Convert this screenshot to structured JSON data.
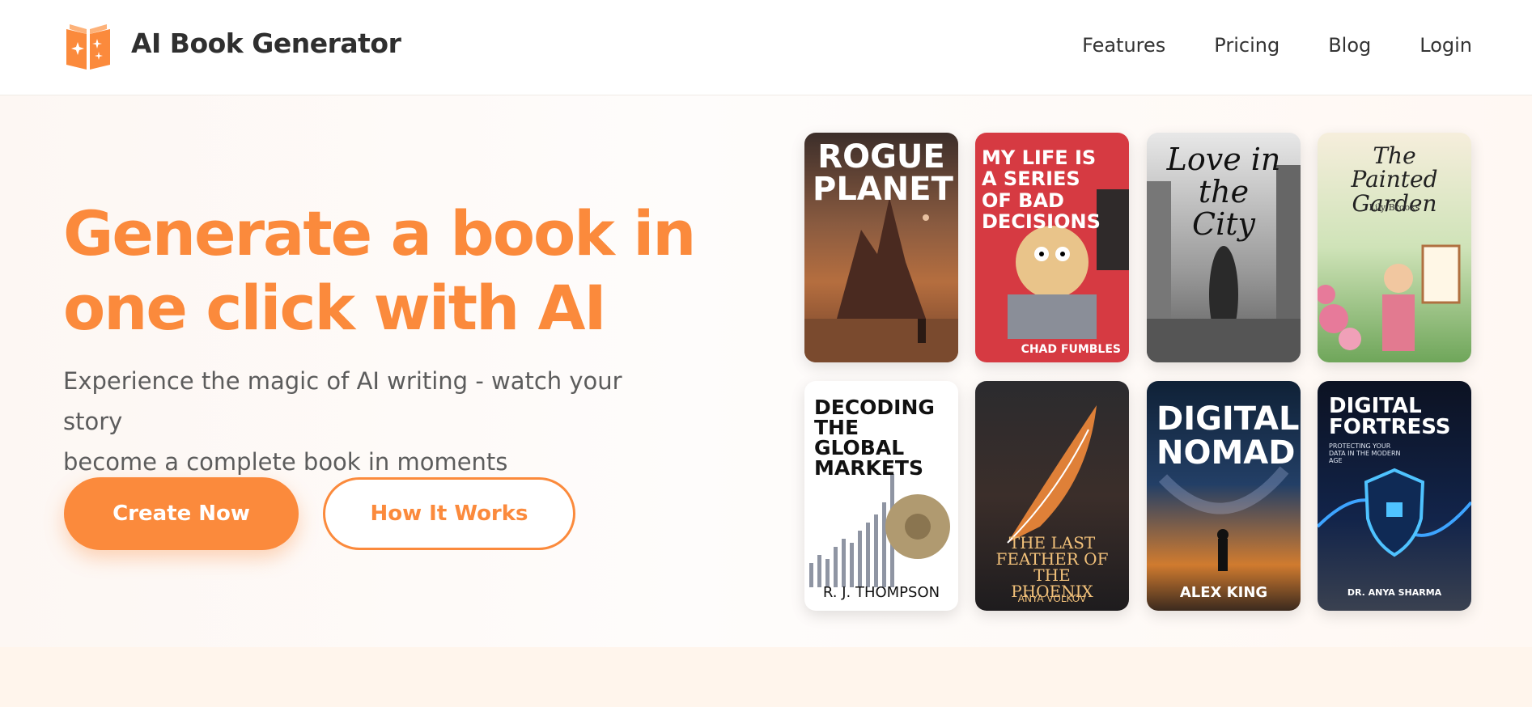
{
  "header": {
    "brand": "AI Book Generator",
    "nav": [
      "Features",
      "Pricing",
      "Blog",
      "Login"
    ]
  },
  "hero": {
    "headline_line1": "Generate a book in",
    "headline_line2": "one click with AI",
    "subtext_line1": "Experience the magic of AI writing - watch your story",
    "subtext_line2": "become a complete book in moments",
    "cta_primary": "Create Now",
    "cta_secondary": "How It Works"
  },
  "colors": {
    "accent": "#fb8a3c",
    "text_dark": "#2f2f2f",
    "text_muted": "#5c5c5c"
  },
  "books": [
    {
      "title": "ROGUE PLANET",
      "author": ""
    },
    {
      "title": "MY LIFE IS A SERIES OF BAD DECISIONS",
      "author": "CHAD FUMBLES"
    },
    {
      "title": "Love in the City",
      "author": ""
    },
    {
      "title": "The Painted Garden",
      "author": "Lily Brooks"
    },
    {
      "title": "DECODING THE GLOBAL MARKETS",
      "author": "R. J. THOMPSON"
    },
    {
      "title": "THE LAST FEATHER OF THE PHOENIX",
      "author": "ANYA VOLKOV"
    },
    {
      "title": "DIGITAL NOMAD",
      "author": "ALEX KING"
    },
    {
      "title": "DIGITAL FORTRESS",
      "subtitle": "PROTECTING YOUR DATA IN THE MODERN AGE",
      "author": "DR. ANYA SHARMA"
    }
  ]
}
